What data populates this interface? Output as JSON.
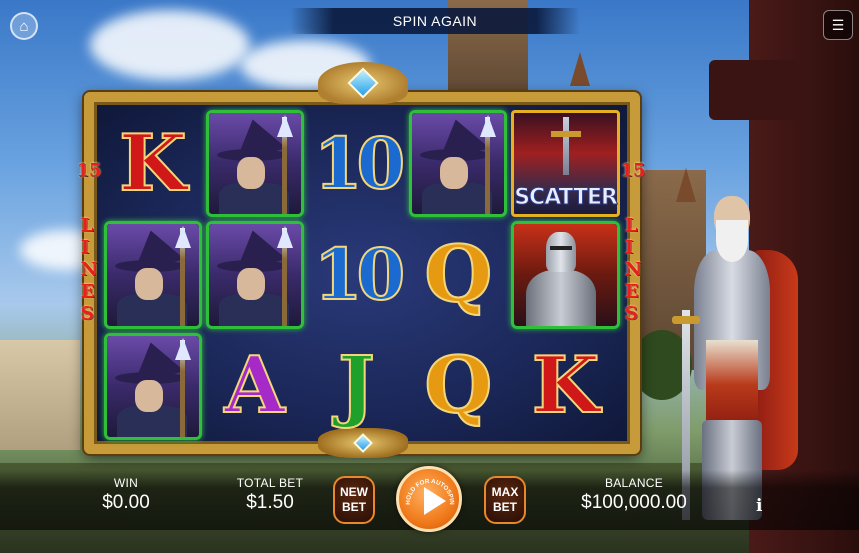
{
  "header": {
    "banner_text": "SPIN AGAIN",
    "home_icon": "home-icon",
    "menu_icon": "menu-icon"
  },
  "lines": {
    "count": "15",
    "word": [
      "L",
      "I",
      "N",
      "E",
      "S"
    ]
  },
  "reels": {
    "rows": [
      [
        {
          "type": "letter",
          "text": "K",
          "color": "#d01818"
        },
        {
          "type": "wizard",
          "framed": true
        },
        {
          "type": "number",
          "text": "10",
          "color": "#1b6ad0"
        },
        {
          "type": "wizard",
          "framed": true
        },
        {
          "type": "scatter",
          "text": "SCATTER"
        }
      ],
      [
        {
          "type": "wizard",
          "framed": true
        },
        {
          "type": "wizard",
          "framed": true
        },
        {
          "type": "number",
          "text": "10",
          "color": "#1b6ad0"
        },
        {
          "type": "letter",
          "text": "Q",
          "color": "#e69a12"
        },
        {
          "type": "knight",
          "framed": true
        }
      ],
      [
        {
          "type": "wizard",
          "framed": true
        },
        {
          "type": "letter",
          "text": "A",
          "color": "#a52ac8"
        },
        {
          "type": "letter",
          "text": "J",
          "color": "#1fa02a"
        },
        {
          "type": "letter",
          "text": "Q",
          "color": "#e69a12"
        },
        {
          "type": "letter",
          "text": "K",
          "color": "#d01818"
        }
      ]
    ]
  },
  "bottom": {
    "win_label": "WIN",
    "win_value": "$0.00",
    "total_bet_label": "TOTAL BET",
    "total_bet_value": "$1.50",
    "new_bet_line1": "NEW",
    "new_bet_line2": "BET",
    "spin_label": "HOLD FOR AUTOSPIN",
    "max_bet_line1": "MAX",
    "max_bet_line2": "BET",
    "balance_label": "BALANCE",
    "balance_value": "$100,000.00",
    "info_label": "i"
  },
  "colors": {
    "accent_orange": "#f07a1a",
    "frame_gold": "#c79a3a",
    "win_frame_green": "#2fbf3a",
    "lines_red": "#e8201a"
  }
}
